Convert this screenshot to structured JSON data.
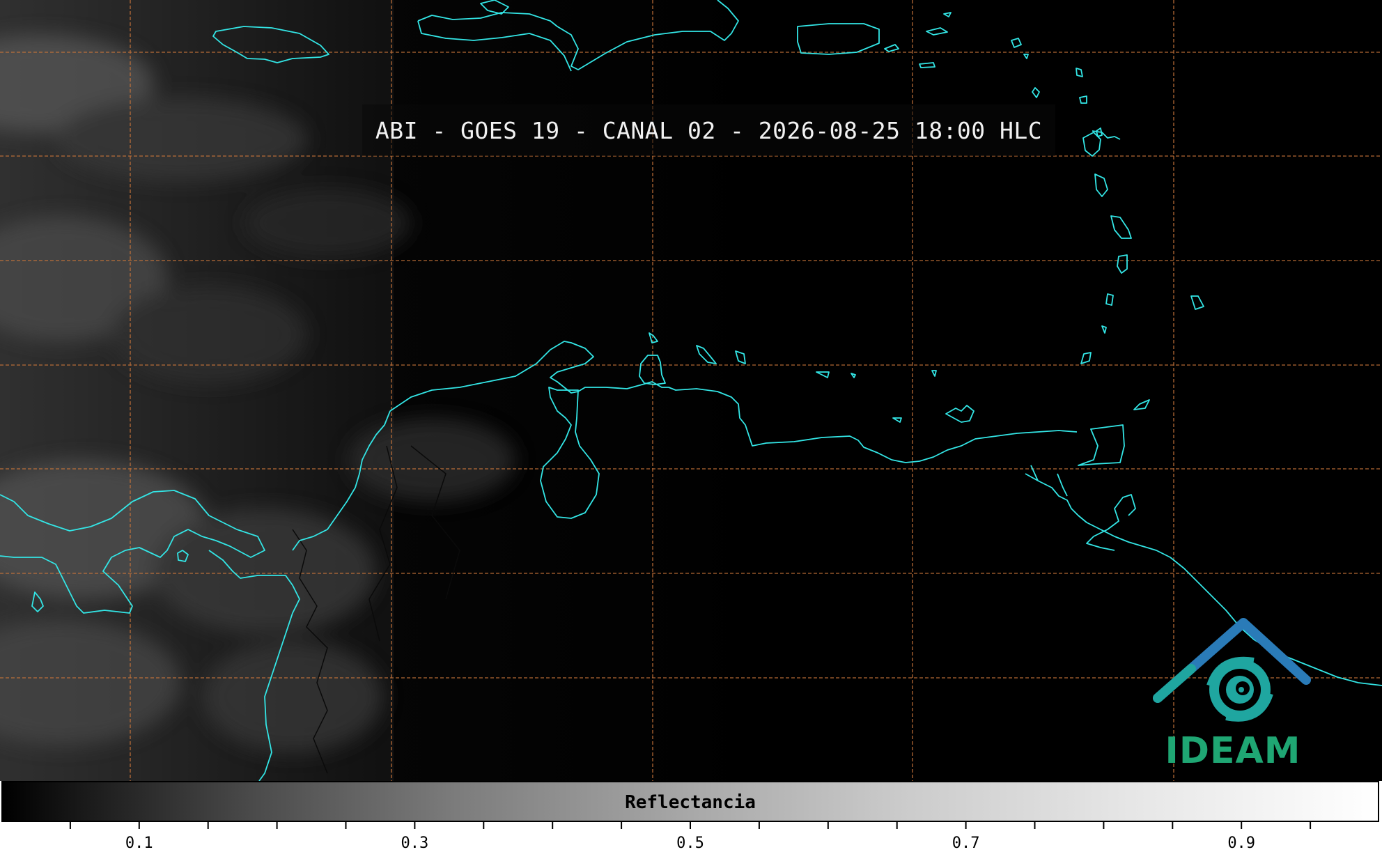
{
  "title": "ABI - GOES 19 - CANAL 02 - 2026-08-25 18:00 HLC",
  "colorbar": {
    "label": "Reflectancia",
    "min": 0.0,
    "max": 1.0,
    "tick_labels": [
      "0.1",
      "0.3",
      "0.5",
      "0.7",
      "0.9"
    ],
    "tick_values": [
      0.1,
      0.3,
      0.5,
      0.7,
      0.9
    ],
    "minor_tick_step": 0.05
  },
  "logo": {
    "text": "IDEAM",
    "icon": "ideam-swirl-icon",
    "colors": {
      "roof": "#2a6fb0",
      "swirl": "#1fa6a0",
      "text": "#1fa673"
    }
  },
  "colors": {
    "coastline": "#33e6e6",
    "gridline": "#c8743a",
    "borders": "#000000",
    "background": "#000000"
  }
}
